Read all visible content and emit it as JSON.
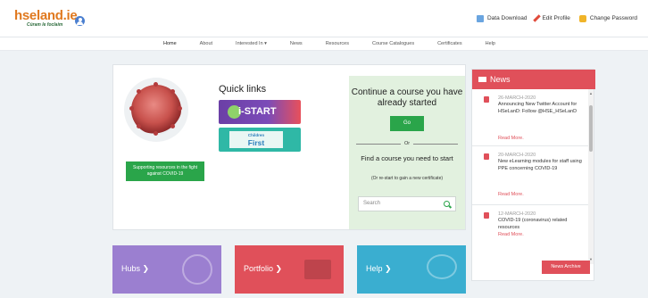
{
  "header": {
    "logo_main": "hseland.ie",
    "logo_tagline": "Cúram le foclaim",
    "links": [
      {
        "label": "Data Download",
        "icon": "download-icon"
      },
      {
        "label": "Edit Profile",
        "icon": "pencil-icon"
      },
      {
        "label": "Change Password",
        "icon": "lock-icon"
      }
    ]
  },
  "nav": {
    "items": [
      "Home",
      "About",
      "Interested In ▾",
      "News",
      "Resources",
      "Course Catalogues",
      "Certificates",
      "Help"
    ]
  },
  "main": {
    "covid_button": "Supporting resources in the fight against COVID-19",
    "quick_links_title": "Quick links",
    "istart_label": "i-START",
    "children_first_top": "Children",
    "children_first_bottom": "First",
    "continue_title": "Continue a course you have already started",
    "go_label": "Go",
    "or_label": "Or",
    "find_title": "Find a course you need to start",
    "find_sub": "(Or re-start to gain a new certificate)",
    "search_placeholder": "Search"
  },
  "news": {
    "title": "News",
    "items": [
      {
        "date": "26-MARCH-2020",
        "text": "Announcing New Twitter Account for HSeLanD: Follow @HSE_HSeLanD",
        "more": "Read More."
      },
      {
        "date": "20-MARCH-2020",
        "text": "New eLearning modules for staff using PPE concerning COVID-19",
        "more": "Read More."
      },
      {
        "date": "12-MARCH-2020",
        "text": "COVID-19 (coronavirus) related resources",
        "more": "Read More."
      }
    ],
    "archive_label": "News Archive"
  },
  "tiles": {
    "hubs": "Hubs ❯",
    "portfolio": "Portfolio ❯",
    "help": "Help ❯"
  },
  "colors": {
    "accent_red": "#e0505a",
    "accent_green": "#2aa54a",
    "hubs_purple": "#9b7fd0",
    "help_blue": "#3aaed0",
    "logo_orange": "#e0791f"
  }
}
